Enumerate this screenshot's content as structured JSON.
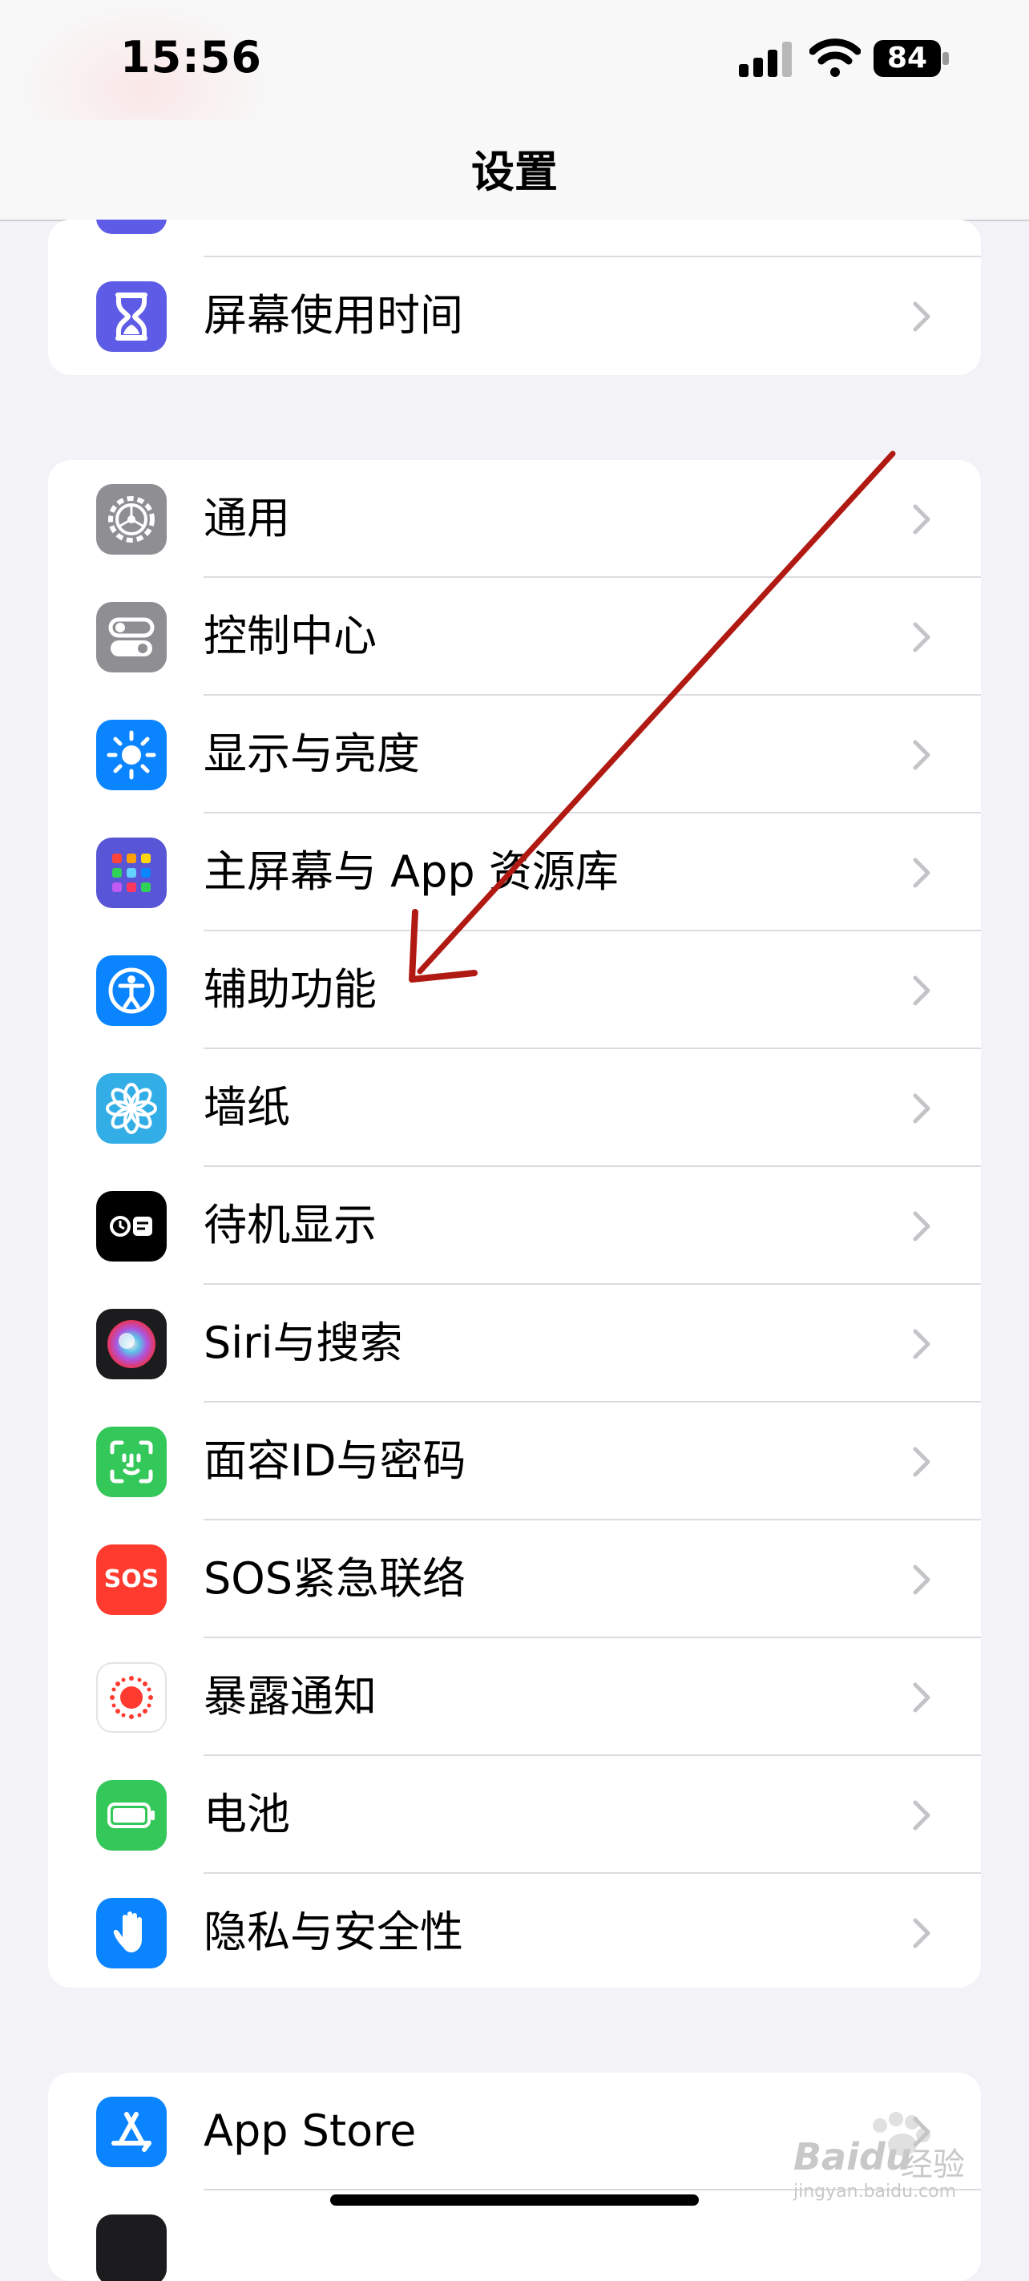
{
  "status_bar": {
    "time": "15:56",
    "battery": "84"
  },
  "header": {
    "title": "设置"
  },
  "groups": [
    {
      "items": [
        {
          "label": "",
          "icon": "partial-purple-icon",
          "color": "#5e5ce6"
        },
        {
          "label": "屏幕使用时间",
          "icon": "hourglass-icon",
          "color": "#5e5ce6"
        }
      ]
    },
    {
      "items": [
        {
          "label": "通用",
          "icon": "gear-icon",
          "color": "#8e8e93"
        },
        {
          "label": "控制中心",
          "icon": "toggles-icon",
          "color": "#8e8e93"
        },
        {
          "label": "显示与亮度",
          "icon": "sun-icon",
          "color": "#0a84ff"
        },
        {
          "label": "主屏幕与 App 资源库",
          "icon": "app-grid-icon",
          "color": "#5856d6"
        },
        {
          "label": "辅助功能",
          "icon": "accessibility-icon",
          "color": "#0a84ff"
        },
        {
          "label": "墙纸",
          "icon": "flower-icon",
          "color": "#32ade6"
        },
        {
          "label": "待机显示",
          "icon": "standby-icon",
          "color": "#000000"
        },
        {
          "label": "Siri与搜索",
          "icon": "siri-icon",
          "color": "#1c1c1e"
        },
        {
          "label": "面容ID与密码",
          "icon": "face-id-icon",
          "color": "#34c759"
        },
        {
          "label": "SOS紧急联络",
          "icon": "sos-icon",
          "color": "#ff3b30"
        },
        {
          "label": "暴露通知",
          "icon": "exposure-icon",
          "color": "#ffffff"
        },
        {
          "label": "电池",
          "icon": "battery-icon",
          "color": "#34c759"
        },
        {
          "label": "隐私与安全性",
          "icon": "hand-icon",
          "color": "#0a84ff"
        }
      ]
    },
    {
      "items": [
        {
          "label": "App Store",
          "icon": "app-store-icon",
          "color": "#0a84ff"
        }
      ]
    }
  ],
  "icon_text": {
    "sos": "SOS"
  },
  "watermark": {
    "word": "Baidu",
    "cn": "经验",
    "url": "jingyan.baidu.com"
  },
  "colors": {
    "background": "#f2f2f7",
    "annotation_arrow": "#b01a12"
  }
}
